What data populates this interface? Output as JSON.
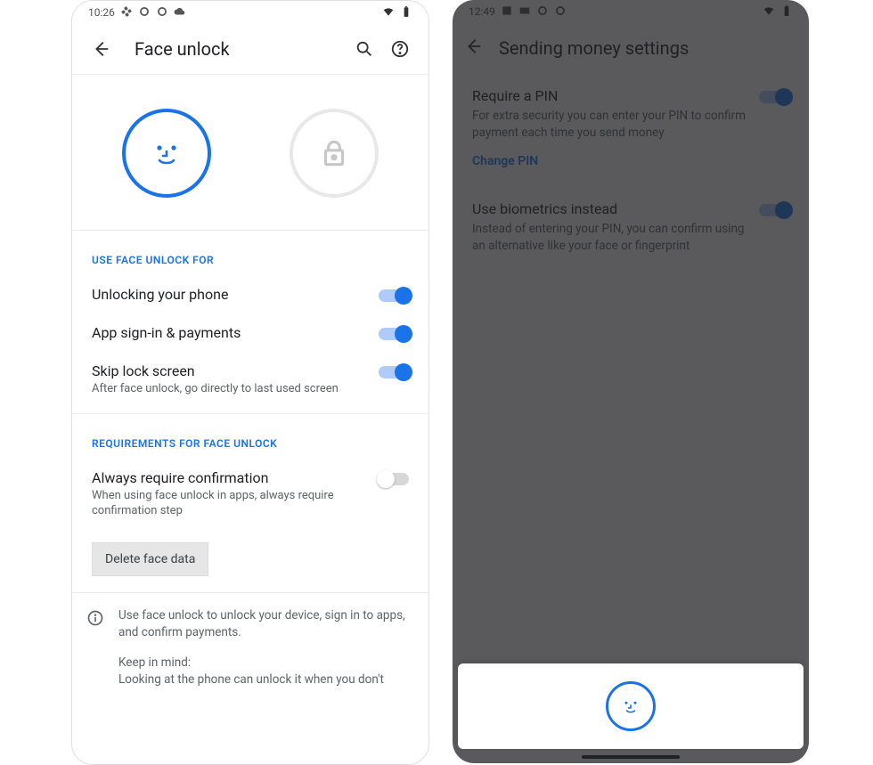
{
  "left": {
    "status_time": "10:26",
    "title": "Face unlock",
    "section1_label": "USE FACE UNLOCK FOR",
    "r1": "Unlocking your phone",
    "r2": "App sign-in & payments",
    "r3_t": "Skip lock screen",
    "r3_s": "After face unlock, go directly to last used screen",
    "section2_label": "REQUIREMENTS FOR FACE UNLOCK",
    "r4_t": "Always require confirmation",
    "r4_s": "When using face unlock in apps, always require confirmation step",
    "delete_btn": "Delete face data",
    "info1": "Use face unlock to unlock your device, sign in to apps, and confirm payments.",
    "info2a": "Keep in mind:",
    "info2b": "Looking at the phone can unlock it when you don't"
  },
  "right": {
    "status_time": "12:49",
    "title": "Sending money settings",
    "b1_t": "Require a PIN",
    "b1_s": "For extra security you can enter your PIN to confirm payment each time you send money",
    "b1_link": "Change PIN",
    "b2_t": "Use biometrics instead",
    "b2_s": "Instead of entering your PIN, you can confirm using an alternative like your face or fingerprint"
  }
}
